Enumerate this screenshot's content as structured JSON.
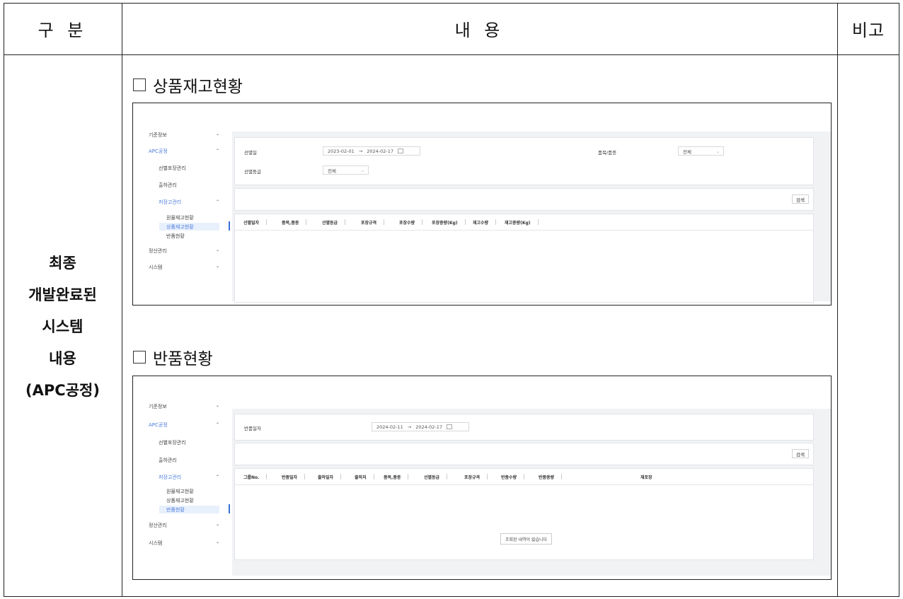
{
  "header": {
    "col1": "구 분",
    "col2": "내 용",
    "col3": "비고"
  },
  "category": {
    "lines": [
      "최종",
      "개발완료된",
      "시스템",
      "내용",
      "(APC공정)"
    ]
  },
  "section1": {
    "title": "상품재고현황",
    "nav": {
      "items": [
        "기준정보",
        "APC공정",
        "선별포장관리",
        "출하관리",
        "저장고관리",
        "원물재고현황",
        "상품재고현황",
        "반품현황",
        "정산관리",
        "시스템"
      ]
    },
    "search": {
      "label_date": "선별일",
      "date_from": "2023-02-01",
      "date_to": "2024-02-17",
      "label_item": "품목/품종",
      "item_value": "전체",
      "label_grade": "선별등급",
      "grade_value": "전체"
    },
    "search_button": "검색",
    "columns": [
      "선별일자",
      "품목,품종",
      "선별등급",
      "포장규격",
      "포장수량",
      "포장중량(Kg)",
      "재고수량",
      "재고중량(Kg)"
    ]
  },
  "section2": {
    "title": "반품현황",
    "nav": {
      "items": [
        "기준정보",
        "APC공정",
        "선별포장관리",
        "출하관리",
        "저장고관리",
        "원물재고현황",
        "상품재고현황",
        "반품현황",
        "정산관리",
        "시스템"
      ]
    },
    "search": {
      "label_date": "반품일자",
      "date_from": "2024-02-11",
      "date_to": "2024-02-17"
    },
    "search_button": "검색",
    "columns": [
      "그룹No.",
      "반품일자",
      "출하일자",
      "출하처",
      "품목,품종",
      "선별등급",
      "포장규격",
      "반품수량",
      "반품중량",
      "재포장"
    ],
    "empty_message": "조회된 내역이 없습니다"
  },
  "icons": {
    "arrow": "→",
    "calendar": "calendar-icon",
    "chevron_down": "⌄",
    "chevron_up": "⌃",
    "checkbox": "empty-square"
  }
}
